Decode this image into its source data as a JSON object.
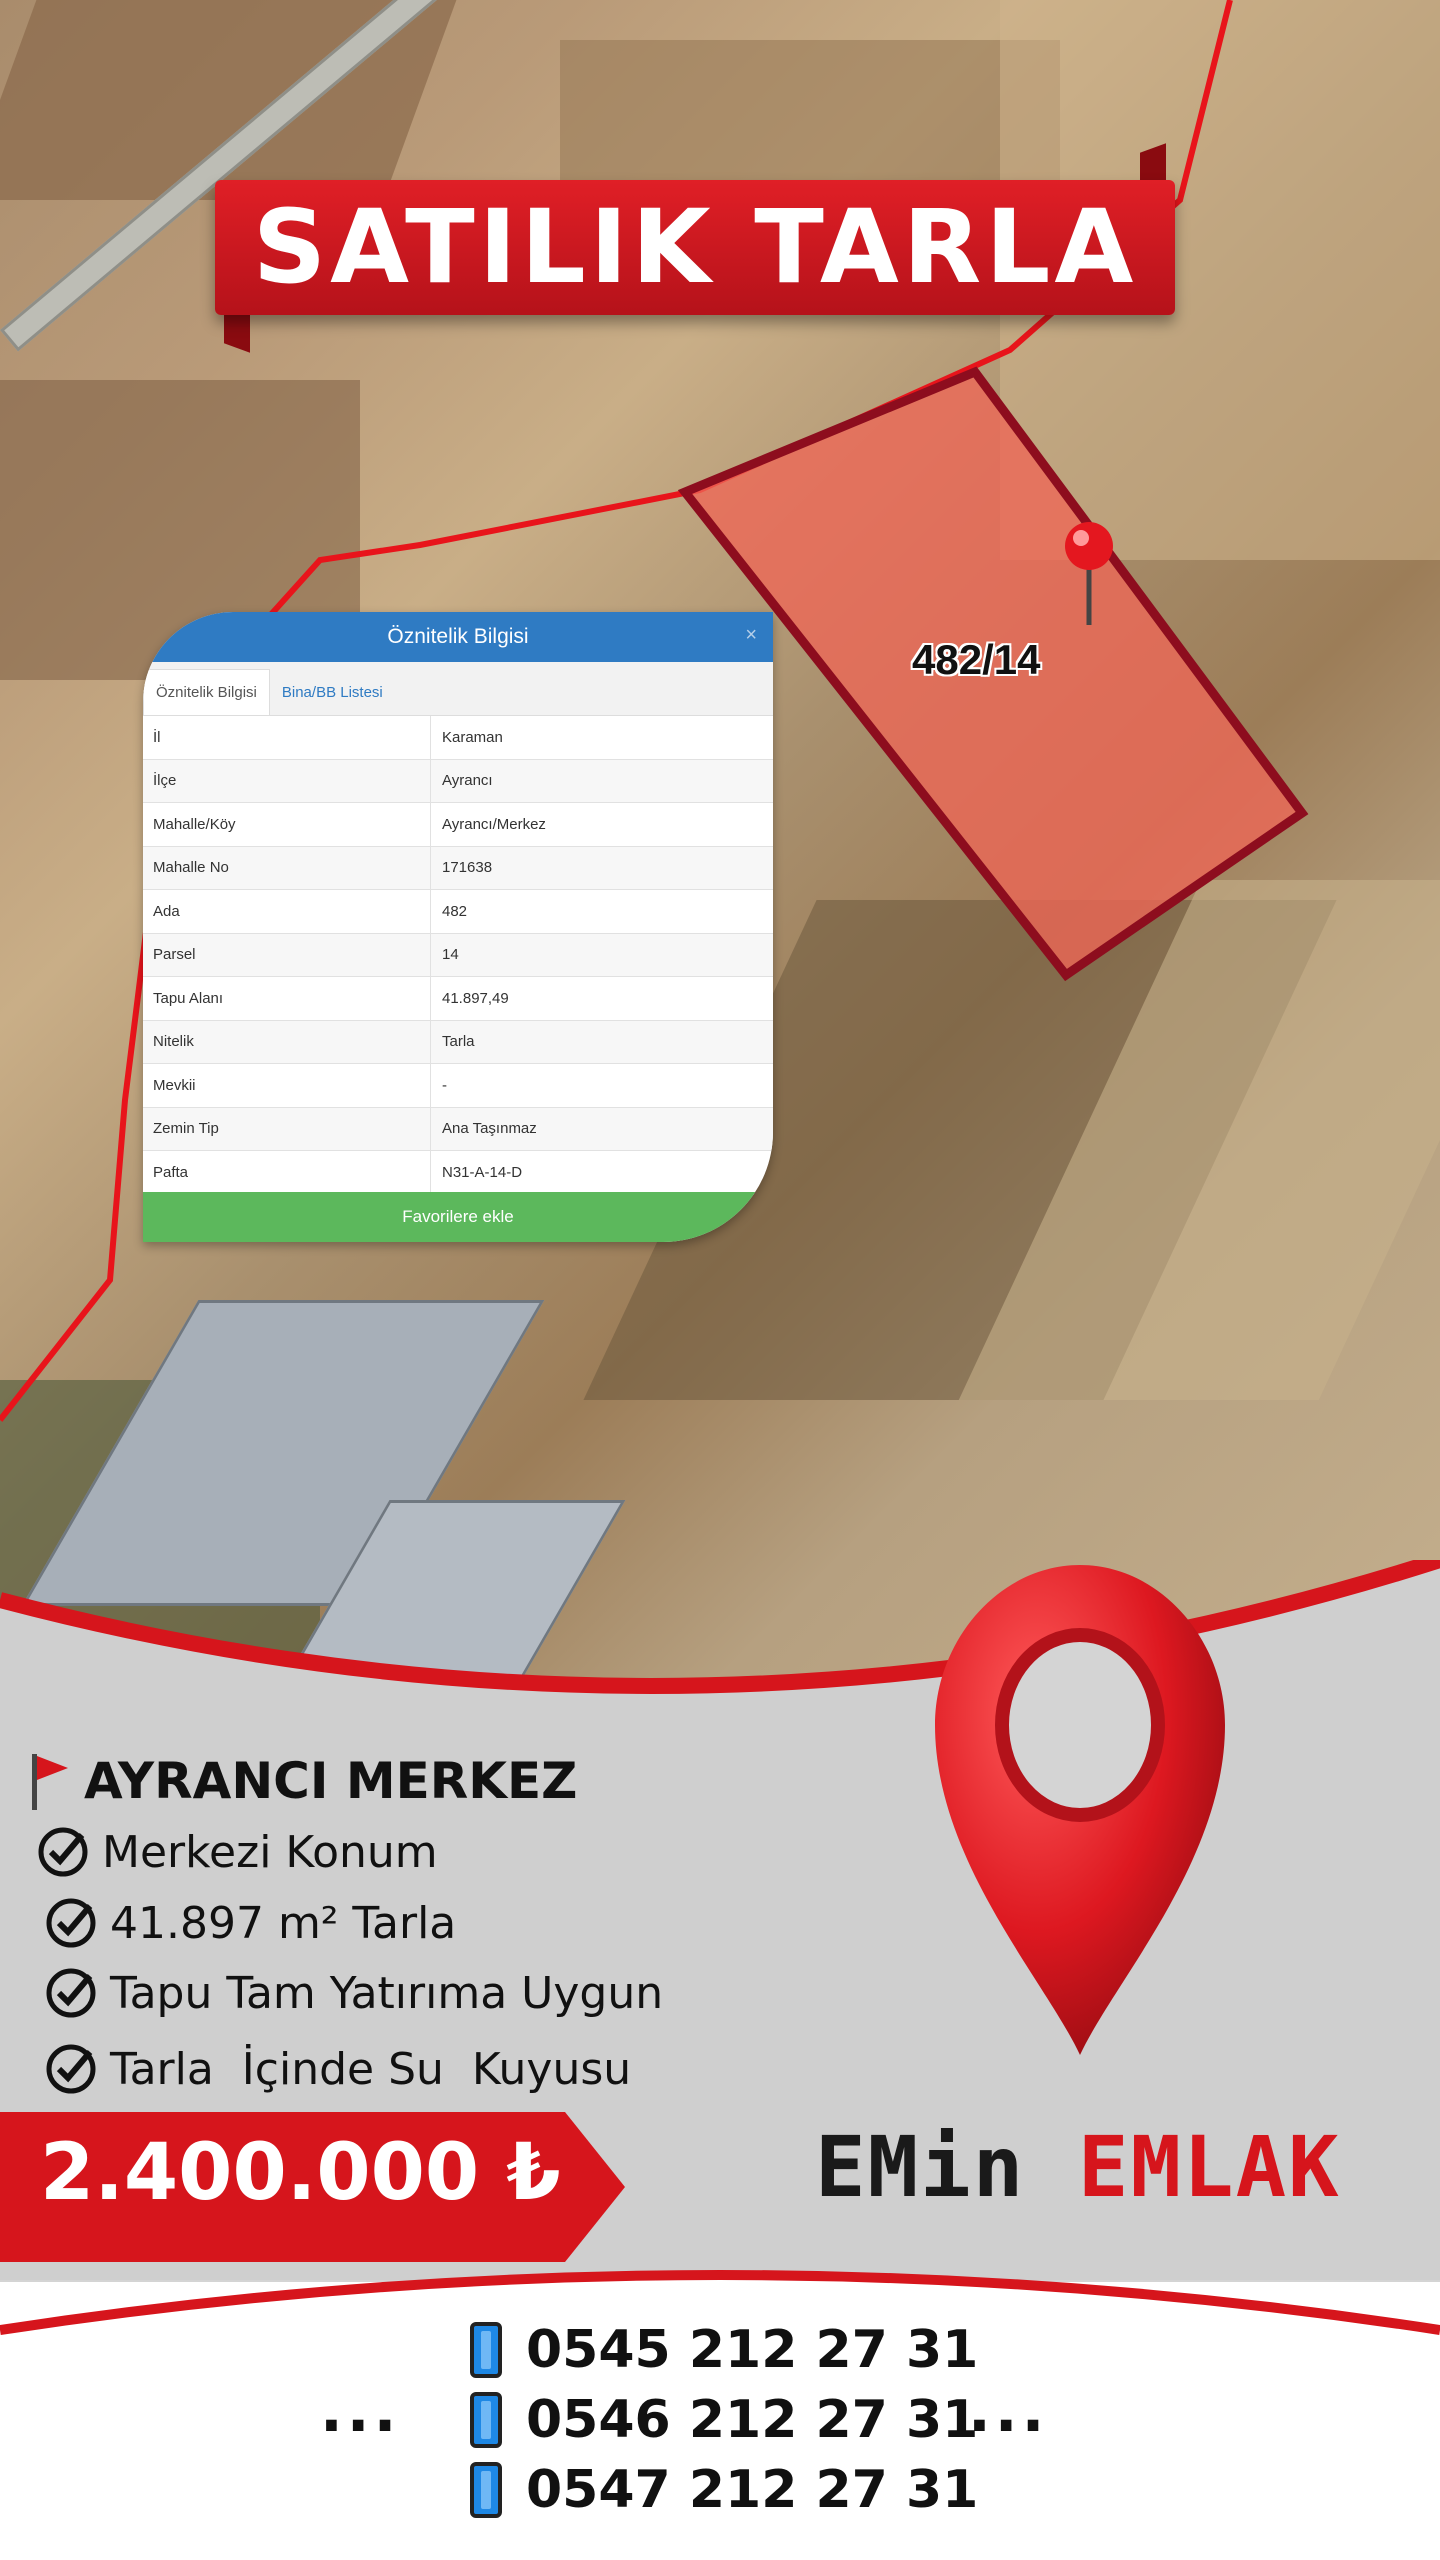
{
  "banner": {
    "title": "SATILIK TARLA"
  },
  "map": {
    "parcel_label": "482/14"
  },
  "panel": {
    "title": "Öznitelik Bilgisi",
    "close": "×",
    "tabs": [
      "Öznitelik Bilgisi",
      "Bina/BB Listesi"
    ],
    "rows": [
      {
        "k": "İl",
        "v": "Karaman"
      },
      {
        "k": "İlçe",
        "v": "Ayrancı"
      },
      {
        "k": "Mahalle/Köy",
        "v": "Ayrancı/Merkez"
      },
      {
        "k": "Mahalle No",
        "v": "171638"
      },
      {
        "k": "Ada",
        "v": "482"
      },
      {
        "k": "Parsel",
        "v": "14"
      },
      {
        "k": "Tapu Alanı",
        "v": "41.897,49"
      },
      {
        "k": "Nitelik",
        "v": "Tarla"
      },
      {
        "k": "Mevkii",
        "v": "-"
      },
      {
        "k": "Zemin Tip",
        "v": "Ana Taşınmaz"
      },
      {
        "k": "Pafta",
        "v": "N31-A-14-D"
      }
    ],
    "favorite_button": "Favorilere ekle"
  },
  "listing": {
    "location": "AYRANCI MERKEZ",
    "features": [
      "Merkezi Konum",
      "41.897 m² Tarla",
      "Tapu Tam Yatırıma Uygun",
      "Tarla  İçinde Su  Kuyusu"
    ],
    "price": "2.400.000 ₺"
  },
  "brand": {
    "part1": "EMin",
    "part2": "EMLAK"
  },
  "contact": {
    "phones": [
      "0545 212 27 31",
      "0546 212 27 31",
      "0547 212 27 31"
    ],
    "dots": "..."
  },
  "colors": {
    "accent_red": "#d6151c",
    "panel_blue": "#2f7bc3",
    "button_green": "#5cb85c"
  },
  "icons": [
    "flag-icon",
    "check-circle-icon",
    "phone-icon",
    "location-pin-icon"
  ]
}
